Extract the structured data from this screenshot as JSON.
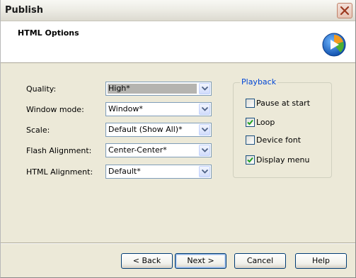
{
  "window": {
    "title": "Publish"
  },
  "header": {
    "title": "HTML Options"
  },
  "form": {
    "fields": [
      {
        "label": "Quality:",
        "value": "High*"
      },
      {
        "label": "Window mode:",
        "value": "Window*"
      },
      {
        "label": "Scale:",
        "value": "Default (Show All)*"
      },
      {
        "label": "Flash Alignment:",
        "value": "Center-Center*"
      },
      {
        "label": "HTML Alignment:",
        "value": "Default*"
      }
    ]
  },
  "playback": {
    "legend": "Playback",
    "options": [
      {
        "label": "Pause at start",
        "checked": false
      },
      {
        "label": "Loop",
        "checked": true
      },
      {
        "label": "Device font",
        "checked": false
      },
      {
        "label": "Display menu",
        "checked": true
      }
    ]
  },
  "buttons": {
    "back": "< Back",
    "next": "Next >",
    "cancel": "Cancel",
    "help": "Help"
  },
  "colors": {
    "accent": "#0046d5",
    "logo_blue": "#1e6fd0",
    "logo_orange": "#f39a1e",
    "logo_green": "#4caf32"
  }
}
